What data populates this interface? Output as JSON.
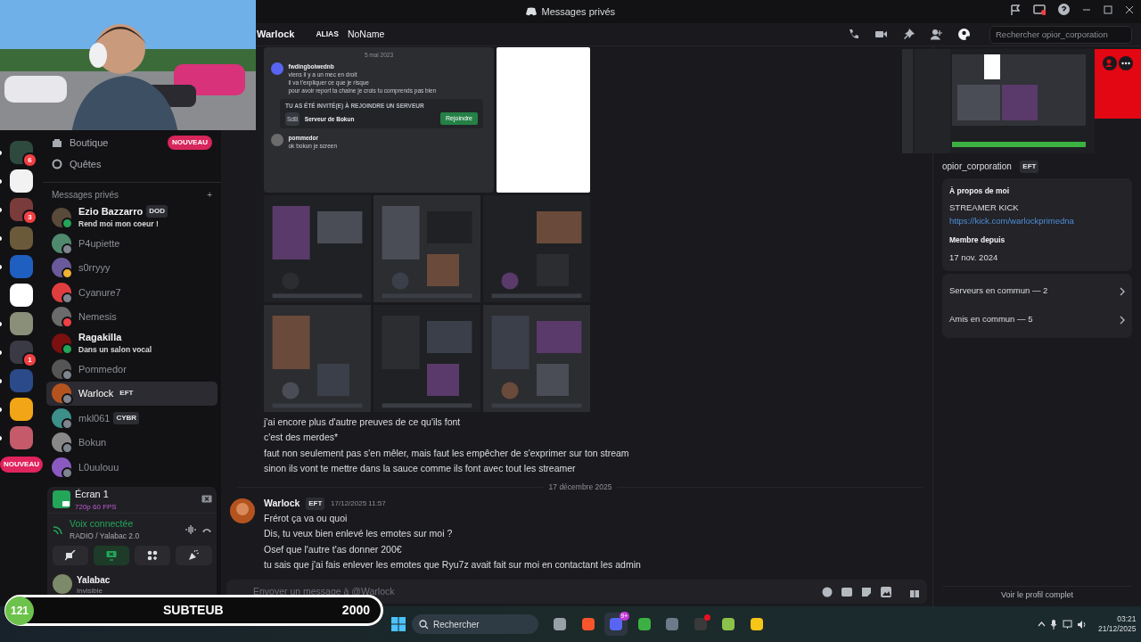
{
  "title_bar": {
    "title": "Messages privés"
  },
  "webcam": {
    "kind": "picture"
  },
  "servers": [
    {
      "color": "#2e4a3f",
      "badge": "6",
      "unread": true
    },
    {
      "color": "#f2f2f2",
      "unread": true
    },
    {
      "color": "#7a3b3b",
      "badge": "3",
      "unread": true
    },
    {
      "color": "#6b5a3a",
      "unread": true
    },
    {
      "color": "#1f5fbf",
      "unread": true
    },
    {
      "color": "#ffffff",
      "unread": false
    },
    {
      "color": "#8a8f7a",
      "unread": true
    },
    {
      "color": "#3a3a44",
      "badge": "1",
      "unread": true
    },
    {
      "color": "#2b4a8a",
      "unread": true
    },
    {
      "color": "#f2a516",
      "unread": true
    },
    {
      "color": "#c45a6a",
      "unread": true
    }
  ],
  "rail_new": "NOUVEAU",
  "nav": [
    {
      "label": "Boutique",
      "badge": "NOUVEAU"
    },
    {
      "label": "Quêtes"
    }
  ],
  "dm_header": {
    "label": "Messages privés",
    "add": "+"
  },
  "dms": [
    {
      "name": "Ezio Bazzarro",
      "tag": "DOD",
      "subtitle": "Rend moi mon coeur !",
      "color": "#23a55a",
      "unread": true,
      "selected": false
    },
    {
      "name": "P4upiette",
      "color": "#80848e",
      "unread": false,
      "selected": false
    },
    {
      "name": "s0rryyy",
      "color": "#f0b232",
      "unread": false,
      "selected": false
    },
    {
      "name": "Cyanure7",
      "color": "#80848e",
      "unread": false,
      "selected": false
    },
    {
      "name": "Nemesis",
      "color": "#f23f43",
      "unread": false,
      "selected": false
    },
    {
      "name": "Ragakilla",
      "subtitle": "Dans un salon vocal",
      "color": "#23a55a",
      "unread": true,
      "selected": false
    },
    {
      "name": "Pommedor",
      "color": "#80848e",
      "unread": false,
      "selected": false
    },
    {
      "name": "Warlock",
      "tag": "EFT",
      "color": "#80848e",
      "unread": false,
      "selected": true
    },
    {
      "name": "mkl061",
      "tag": "CYBR",
      "color": "#80848e",
      "unread": false,
      "selected": false
    },
    {
      "name": "Bokun",
      "color": "#80848e",
      "unread": false,
      "selected": false
    },
    {
      "name": "L0uulouu",
      "color": "#80848e",
      "unread": false,
      "selected": false
    }
  ],
  "stream": {
    "title": "Écran 1",
    "quality": "720p 60 FPS"
  },
  "voice": {
    "status": "Voix connectée",
    "channel": "RADIO / Yalabac 2.0"
  },
  "voice_buttons": [
    {
      "kind": "camera",
      "selected": false
    },
    {
      "kind": "screen",
      "selected": true
    },
    {
      "kind": "activities",
      "selected": false
    },
    {
      "kind": "soundboard",
      "selected": false
    }
  ],
  "user": {
    "name": "Yalabac",
    "status": "Invisible"
  },
  "overlay_bar": {
    "count": "121",
    "label": "SUBTEUB",
    "value": "2000"
  },
  "chat_header": {
    "name": "Warlock",
    "alias_label": "ALIAS",
    "alias": "NoName",
    "search_placeholder": "Rechercher opior_corporation"
  },
  "attachment_screenshot": {
    "date": "5 mai 2023",
    "author": "fwdingboiwednb",
    "lines": [
      "viens il y a un mec en droit",
      "il va t'expliquer ce que je risque",
      "pour avoir report ta chaine je crois tu comprends pas bien"
    ],
    "invite_heading": "TU AS ÉTÉ INVITÉ(E) À REJOINDRE UN SERVEUR",
    "server_initials": "SdB",
    "server_name": "Serveur de Bokun",
    "join": "Rejoindre",
    "reply_author": "pommedor",
    "reply": "ok bokun je screen"
  },
  "attachments": [
    {
      "kind": "blank"
    },
    {
      "kind": "picture"
    },
    {
      "kind": "picture"
    },
    {
      "kind": "picture"
    },
    {
      "kind": "picture"
    },
    {
      "kind": "picture"
    },
    {
      "kind": "picture"
    }
  ],
  "continued_lines": [
    "j'ai encore plus d'autre preuves de ce qu'ils font",
    "c'est des merdes*",
    "faut non seulement pas s'en mêler, mais faut les empêcher de s'exprimer sur ton stream",
    "sinon ils vont te mettre dans la sauce comme ils font avec tout les streamer"
  ],
  "date_divider": "17 décembre 2025",
  "message": {
    "author": "Warlock",
    "tag": "EFT",
    "time": "17/12/2025 11:57",
    "lines": [
      "Frérot ça va ou quoi",
      "Dis, tu veux bien enlevé les emotes sur moi ?",
      "Osef que l'autre t'as donner 200€",
      "tu sais que j'ai fais enlever les emotes que Ryu7z avait fait sur moi en contactant les admin"
    ]
  },
  "composer": {
    "placeholder": "Envoyer un message à @Warlock"
  },
  "stream_preview": {
    "kind": "picture"
  },
  "profile": {
    "handle": "opior_corporation",
    "tag": "EFT",
    "about_label": "À propos de moi",
    "about": "STREAMER KICK",
    "link": "https://kick.com/warlockprimedna",
    "since_label": "Membre depuis",
    "since": "17 nov. 2024",
    "rows": [
      "Serveurs en commun — 2",
      "Amis en commun — 5"
    ],
    "full_profile": "Voir le profil complet"
  },
  "taskbar": {
    "search": "Rechercher",
    "apps": [
      {
        "color": "#9aa0a8",
        "selected": false,
        "notification": false
      },
      {
        "color": "#fb542b",
        "selected": false,
        "notification": false
      },
      {
        "color": "#5865f2",
        "badge": "9+",
        "selected": true,
        "notification": false
      },
      {
        "color": "#3cb043",
        "selected": false,
        "notification": false
      },
      {
        "color": "#6c7a89",
        "selected": false,
        "notification": false
      },
      {
        "color": "#3a3a3a",
        "selected": false,
        "notification": true
      },
      {
        "color": "#8bc34a",
        "selected": false,
        "notification": false
      },
      {
        "color": "#f5c518",
        "selected": false,
        "notification": false
      }
    ],
    "time": "03:21",
    "date": "21/12/2025"
  }
}
